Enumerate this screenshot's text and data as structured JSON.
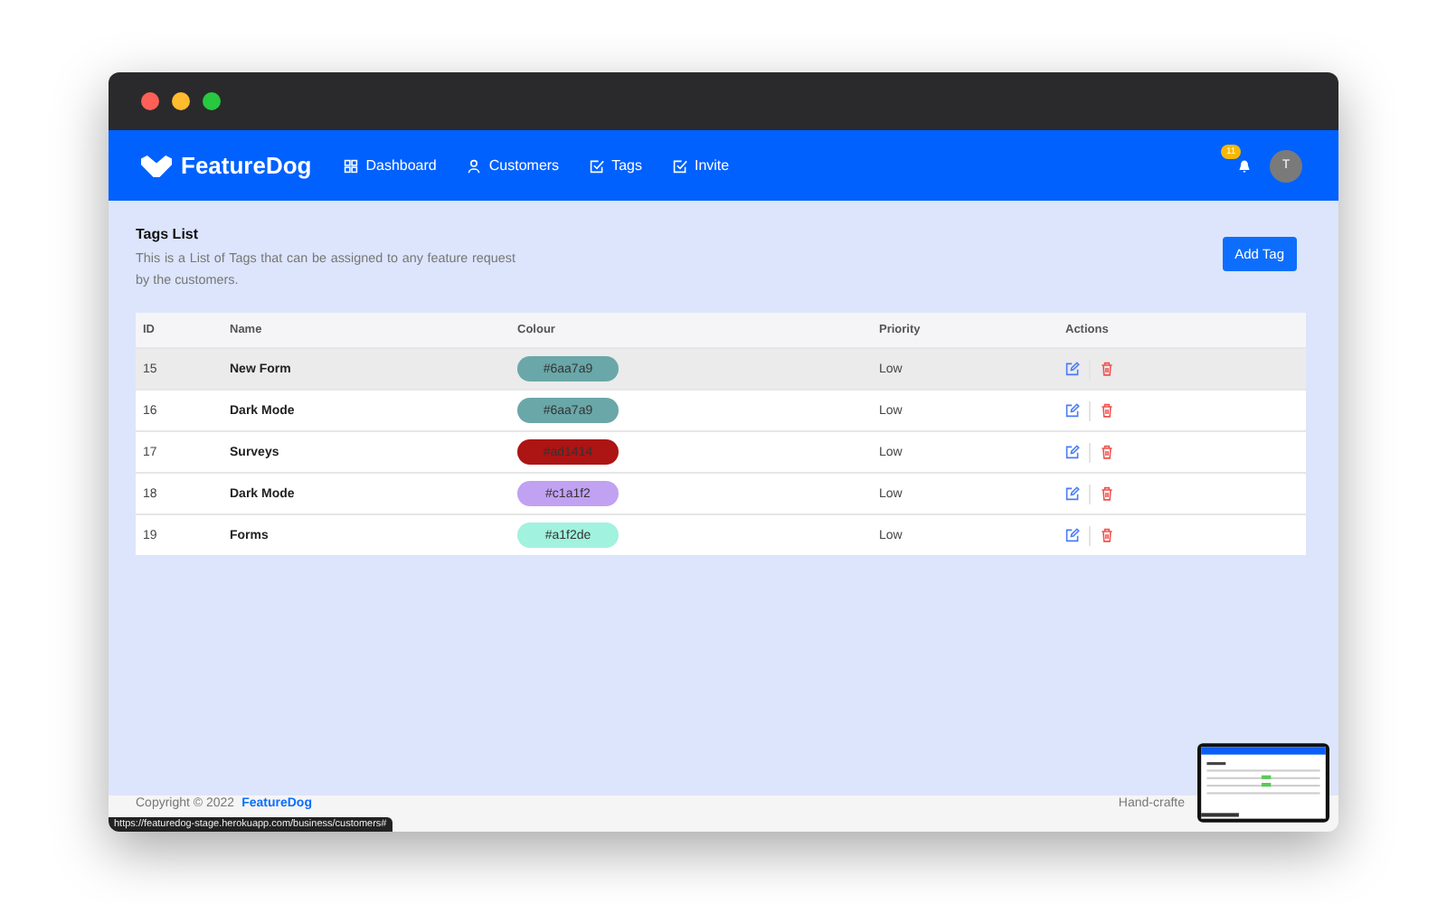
{
  "brand": "FeatureDog",
  "nav": [
    {
      "label": "Dashboard"
    },
    {
      "label": "Customers"
    },
    {
      "label": "Tags"
    },
    {
      "label": "Invite"
    }
  ],
  "notification_count": "11",
  "avatar": "T",
  "page": {
    "title": "Tags List",
    "description": "This is a List of Tags that can be assigned to any feature request by the customers.",
    "add_button": "Add Tag"
  },
  "table": {
    "columns": [
      "ID",
      "Name",
      "Colour",
      "Priority",
      "Actions"
    ],
    "rows": [
      {
        "id": "15",
        "name": "New Form",
        "colour": "#6aa7a9",
        "color": "#6aa7a9",
        "priority": "Low",
        "highlighted": true
      },
      {
        "id": "16",
        "name": "Dark Mode",
        "colour": "#6aa7a9",
        "color": "#6aa7a9",
        "priority": "Low",
        "highlighted": false
      },
      {
        "id": "17",
        "name": "Surveys",
        "colour": "#ad1414",
        "color": "#ad1414",
        "priority": "Low",
        "highlighted": false
      },
      {
        "id": "18",
        "name": "Dark Mode",
        "colour": "#c1a1f2",
        "color": "#c1a1f2",
        "priority": "Low",
        "highlighted": false
      },
      {
        "id": "19",
        "name": "Forms",
        "colour": "#a1f2de",
        "color": "#a1f2de",
        "priority": "Low",
        "highlighted": false
      }
    ]
  },
  "footer": {
    "copyright": "Copyright © 2022",
    "link": "FeatureDog",
    "right": "Hand-crafte"
  },
  "status_url": "https://featuredog-stage.herokuapp.com/business/customers#"
}
